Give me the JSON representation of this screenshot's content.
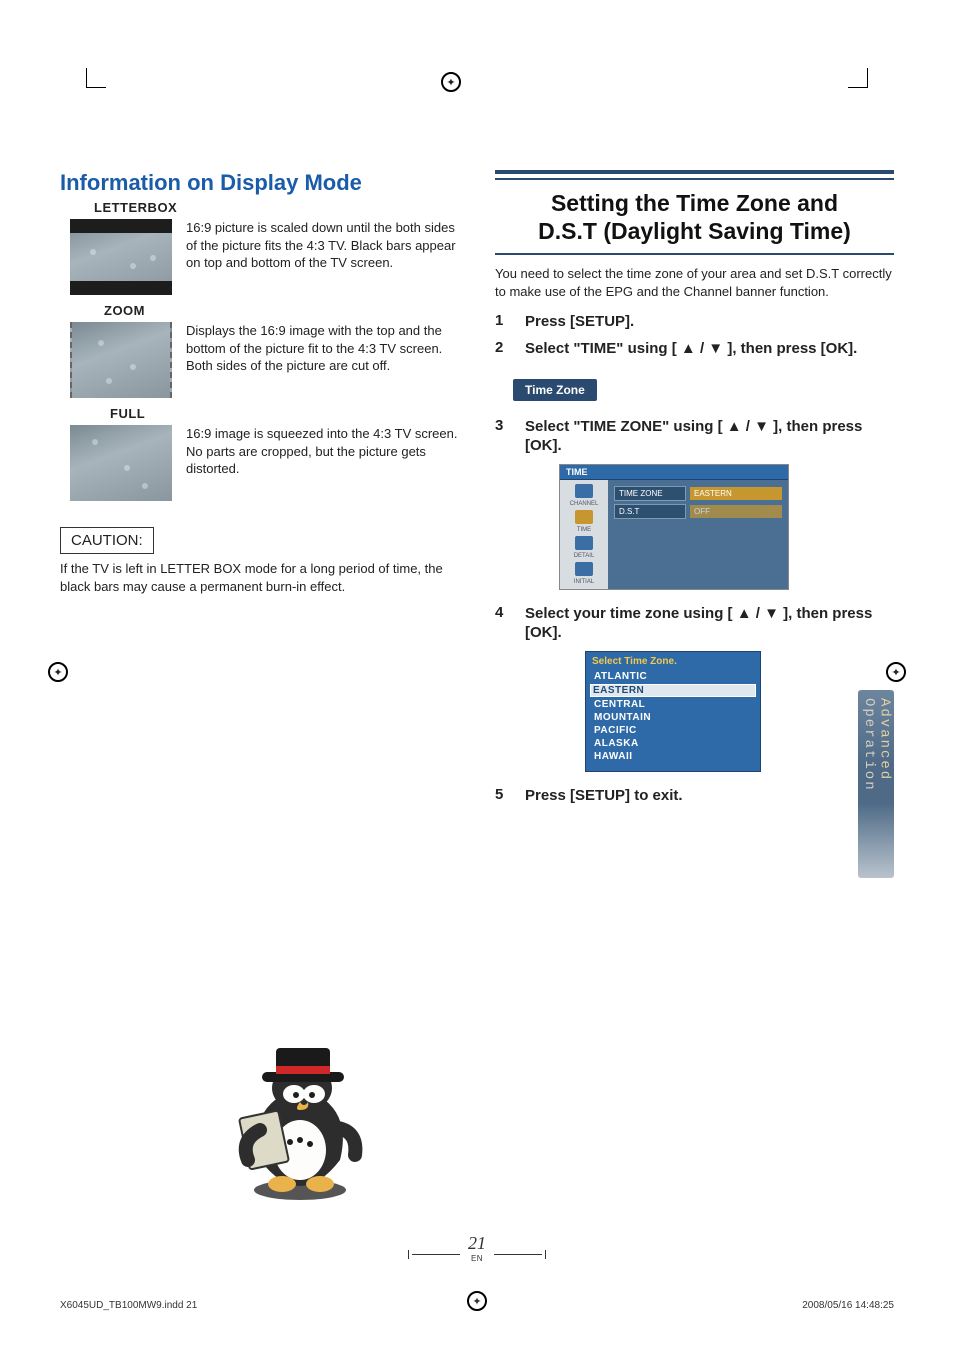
{
  "left": {
    "heading": "Information on Display Mode",
    "letterbox": {
      "label": "LETTERBOX",
      "desc": "16:9 picture is scaled down until the both sides of the picture fits the 4:3 TV. Black bars appear on top and bottom of the TV screen."
    },
    "zoom": {
      "label": "ZOOM",
      "desc": "Displays the 16:9 image with the top and the bottom of the picture fit to the 4:3 TV screen. Both sides of the picture are cut off."
    },
    "full": {
      "label": "FULL",
      "desc": "16:9 image is squeezed into the 4:3 TV screen. No parts are cropped, but the picture gets distorted."
    },
    "caution_label": "CAUTION:",
    "caution_text": "If the TV is left in LETTER BOX mode for a long period of time, the black bars may cause a permanent burn-in effect."
  },
  "right": {
    "title_l1": "Setting the Time Zone and",
    "title_l2": "D.S.T (Daylight Saving Time)",
    "intro": "You need to select the time zone of your area and set D.S.T correctly to make use of the EPG and the Channel banner function.",
    "step1_num": "1",
    "step1": "Press [SETUP].",
    "step2_num": "2",
    "step2_a": "Select \"TIME\" using [",
    "step2_b": "], then press [OK].",
    "tz_label": "Time Zone",
    "step3_num": "3",
    "step3_a": "Select \"TIME ZONE\" using [",
    "step3_b": "], then press [OK].",
    "osd1": {
      "header": "TIME",
      "side": [
        "CHANNEL",
        "TIME",
        "DETAIL",
        "INITIAL"
      ],
      "row1_k": "TIME ZONE",
      "row1_v": "EASTERN",
      "row2_k": "D.S.T",
      "row2_v": "OFF"
    },
    "step4_num": "4",
    "step4_a": "Select your time zone using [",
    "step4_b": "], then press [OK].",
    "osd2": {
      "title": "Select Time Zone.",
      "options": [
        "ATLANTIC",
        "EASTERN",
        "CENTRAL",
        "MOUNTAIN",
        "PACIFIC",
        "ALASKA",
        "HAWAII"
      ],
      "selected_index": 1
    },
    "step5_num": "5",
    "step5": "Press [SETUP] to exit."
  },
  "side_tab_l1": "Advanced",
  "side_tab_l2": "Operation",
  "page_number": "21",
  "page_en": "EN",
  "footer_left": "X6045UD_TB100MW9.indd   21",
  "footer_right": "2008/05/16   14:48:25"
}
